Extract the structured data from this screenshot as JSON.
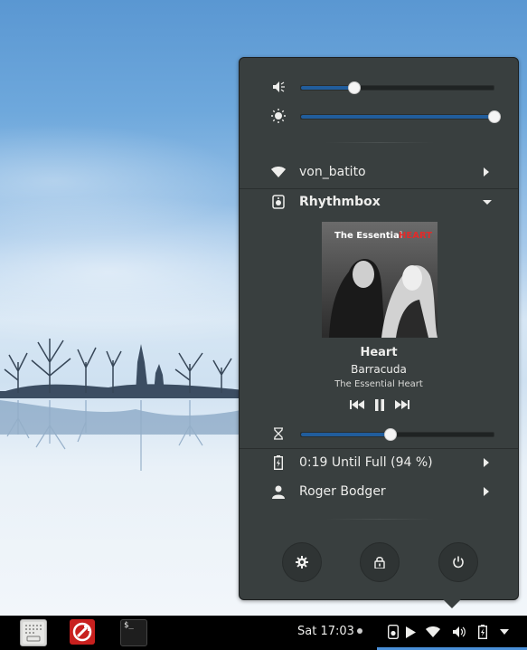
{
  "quick_settings": {
    "volume": {
      "icon": "speaker-muted-icon",
      "level": 0.27
    },
    "brightness": {
      "icon": "brightness-icon",
      "level": 1.0
    },
    "wifi": {
      "icon": "wifi-icon",
      "label": "von_batito"
    },
    "media": {
      "icon": "media-player-icon",
      "player": "Rhythmbox",
      "album_art_text": {
        "title_part1": "The Essential ",
        "title_part2": "HEART"
      },
      "artist": "Heart",
      "title": "Barracuda",
      "album": "The Essential Heart",
      "progress": 0.46
    },
    "battery": {
      "icon": "battery-charging-icon",
      "label": "0:19 Until Full (94 %)"
    },
    "user": {
      "icon": "user-icon",
      "label": "Roger Bodger"
    },
    "buttons": [
      "settings-icon",
      "lock-icon",
      "power-icon"
    ]
  },
  "panel": {
    "clock": "Sat 17:03",
    "launchers": [
      "file-manager-icon",
      "app-icon-red",
      "terminal-icon"
    ],
    "terminal_prompt": "$_",
    "tray": [
      "media-player-icon",
      "play-icon",
      "wifi-icon",
      "volume-icon",
      "battery-charging-icon",
      "dropdown-arrow-icon"
    ]
  },
  "colors": {
    "menu_bg": "#393f3f",
    "accent": "#215d9c",
    "panel_bg": "#000000"
  }
}
